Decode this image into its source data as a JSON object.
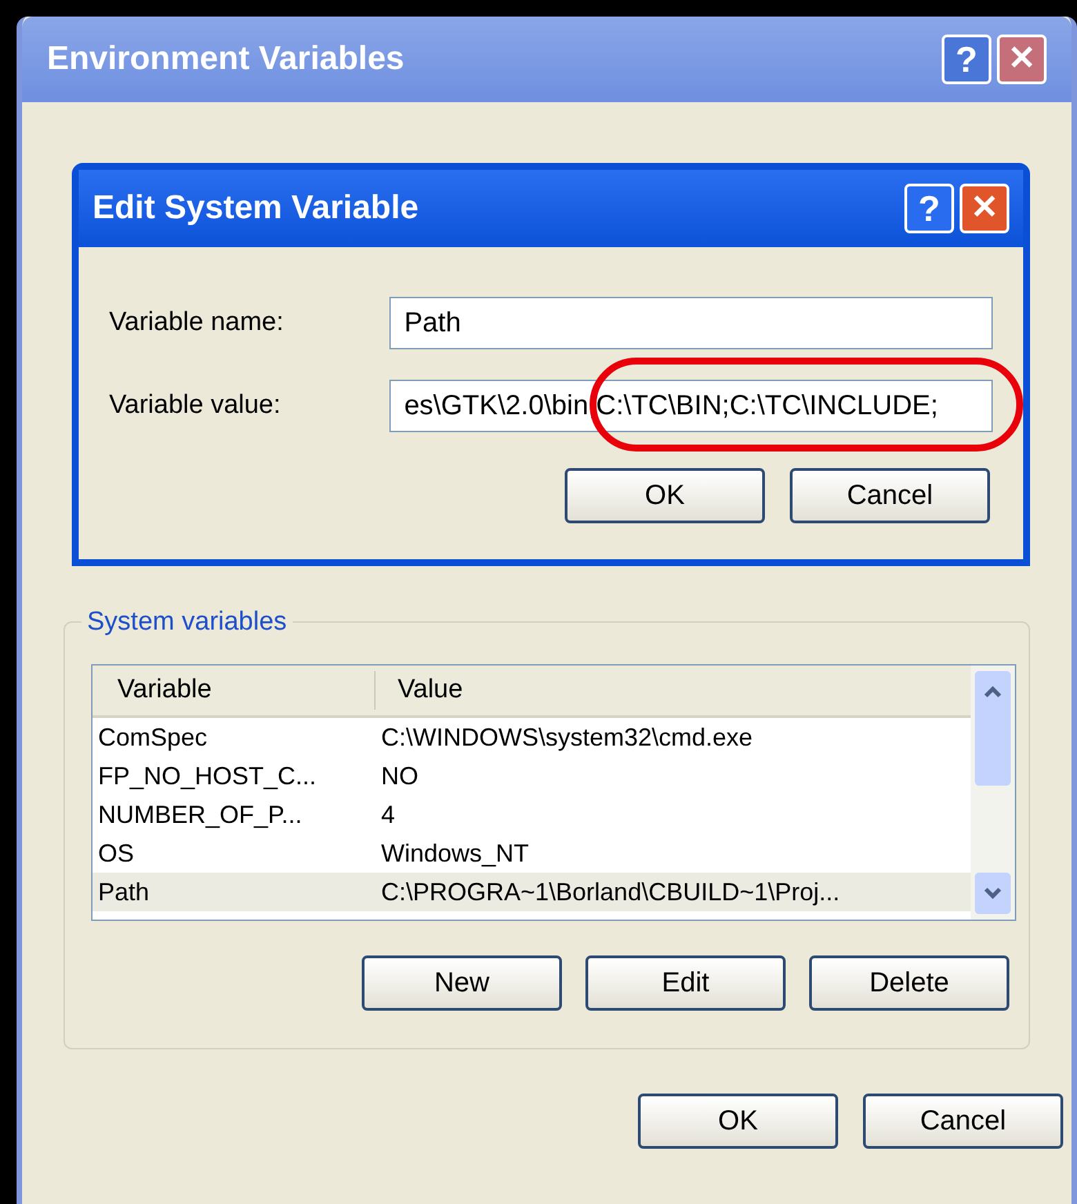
{
  "window": {
    "title": "Environment Variables",
    "buttons": [
      "?",
      "✕"
    ]
  },
  "dialog": {
    "title": "Edit System Variable",
    "buttons": [
      "?",
      "✕"
    ],
    "fields": [
      {
        "label": "Variable name:",
        "value": "Path"
      },
      {
        "label": "Variable value:",
        "value": "es\\GTK\\2.0\\bin;C:\\TC\\BIN;C:\\TC\\INCLUDE;",
        "annotated": true
      }
    ],
    "actions": [
      "OK",
      "Cancel"
    ]
  },
  "system_variables": {
    "title": "System variables",
    "columns": [
      "Variable",
      "Value"
    ],
    "rows": [
      {
        "variable": "ComSpec",
        "value": "C:\\WINDOWS\\system32\\cmd.exe",
        "selected": false
      },
      {
        "variable": "FP_NO_HOST_C...",
        "value": "NO",
        "selected": false
      },
      {
        "variable": "NUMBER_OF_P...",
        "value": "4",
        "selected": false
      },
      {
        "variable": "OS",
        "value": "Windows_NT",
        "selected": false
      },
      {
        "variable": "Path",
        "value": "C:\\PROGRA~1\\Borland\\CBUILD~1\\Proj...",
        "selected": true
      }
    ],
    "actions": [
      "New",
      "Edit",
      "Delete"
    ]
  },
  "actions": [
    "OK",
    "Cancel"
  ]
}
